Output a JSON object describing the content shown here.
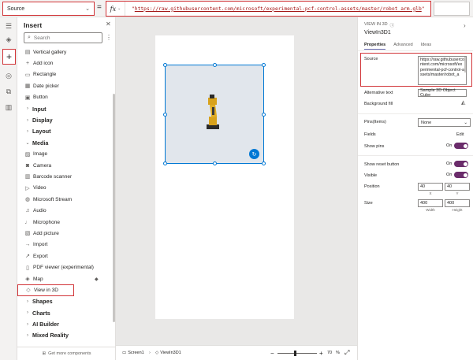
{
  "formula_bar": {
    "property": "Source",
    "fx": "fx",
    "formula_quote_open": "\"",
    "formula_url": "https://raw.githubusercontent.com/microsoft/experimental-pcf-control-assets/master/robot_arm.glb",
    "formula_quote_close": "\""
  },
  "insert_panel": {
    "title": "Insert",
    "search_placeholder": "Search",
    "items": [
      {
        "type": "item",
        "icon": "gallery-icon",
        "glyph": "▤",
        "label": "Vertical gallery"
      },
      {
        "type": "item",
        "icon": "add-icon-icon",
        "glyph": "+",
        "label": "Add icon"
      },
      {
        "type": "item",
        "icon": "rectangle-icon",
        "glyph": "▭",
        "label": "Rectangle"
      },
      {
        "type": "item",
        "icon": "calendar-icon",
        "glyph": "▦",
        "label": "Date picker"
      },
      {
        "type": "item",
        "icon": "button-icon",
        "glyph": "▣",
        "label": "Button"
      },
      {
        "type": "cat",
        "label": "Input"
      },
      {
        "type": "cat",
        "label": "Display"
      },
      {
        "type": "cat",
        "label": "Layout"
      },
      {
        "type": "cat-open",
        "label": "Media"
      },
      {
        "type": "item",
        "icon": "image-icon",
        "glyph": "▨",
        "label": "Image"
      },
      {
        "type": "item",
        "icon": "camera-icon",
        "glyph": "◙",
        "label": "Camera"
      },
      {
        "type": "item",
        "icon": "barcode-icon",
        "glyph": "▥",
        "label": "Barcode scanner"
      },
      {
        "type": "item",
        "icon": "video-icon",
        "glyph": "▷",
        "label": "Video"
      },
      {
        "type": "item",
        "icon": "stream-icon",
        "glyph": "◍",
        "label": "Microsoft Stream"
      },
      {
        "type": "item",
        "icon": "audio-icon",
        "glyph": "♫",
        "label": "Audio"
      },
      {
        "type": "item",
        "icon": "microphone-icon",
        "glyph": "♩",
        "label": "Microphone"
      },
      {
        "type": "item",
        "icon": "add-picture-icon",
        "glyph": "▧",
        "label": "Add picture"
      },
      {
        "type": "item",
        "icon": "import-icon",
        "glyph": "→",
        "label": "Import"
      },
      {
        "type": "item",
        "icon": "export-icon",
        "glyph": "↗",
        "label": "Export"
      },
      {
        "type": "item",
        "icon": "pdf-icon",
        "glyph": "▯",
        "label": "PDF viewer (experimental)"
      },
      {
        "type": "item",
        "icon": "map-icon",
        "glyph": "◈",
        "label": "Map",
        "suffix": "◆"
      },
      {
        "type": "item-hl",
        "icon": "cube-icon",
        "glyph": "◇",
        "label": "View in 3D"
      },
      {
        "type": "cat",
        "label": "Shapes"
      },
      {
        "type": "cat",
        "label": "Charts"
      },
      {
        "type": "cat",
        "label": "AI Builder"
      },
      {
        "type": "cat",
        "label": "Mixed Reality"
      }
    ],
    "get_more": "Get more components"
  },
  "bottom_bar": {
    "screen": "Screen1",
    "control": "ViewIn3D1",
    "zoom_minus": "−",
    "zoom_plus": "+",
    "zoom": "70",
    "zoom_unit": "%"
  },
  "properties_panel": {
    "type_label": "VIEW IN 3D",
    "control_name": "ViewIn3D1",
    "tabs": [
      "Properties",
      "Advanced",
      "Ideas"
    ],
    "source_label": "Source",
    "source_value": "https://raw.githubusercontent.com/microsoft/experimental-pcf-control-assets/master/robot_a",
    "alt_label": "Alternative text",
    "alt_value": "Sample 3D Object Cube",
    "bg_label": "Background fill",
    "pins_label": "Pins(Items)",
    "pins_value": "None",
    "fields_label": "Fields",
    "fields_action": "Edit",
    "show_pins_label": "Show pins",
    "show_pins_state": "On",
    "reset_label": "Show reset button",
    "reset_state": "On",
    "visible_label": "Visible",
    "visible_state": "On",
    "position_label": "Position",
    "pos_x": "40",
    "pos_y": "40",
    "pos_x_label": "X",
    "pos_y_label": "Y",
    "size_label": "Size",
    "width": "400",
    "height": "400",
    "width_label": "Width",
    "height_label": "Height"
  }
}
